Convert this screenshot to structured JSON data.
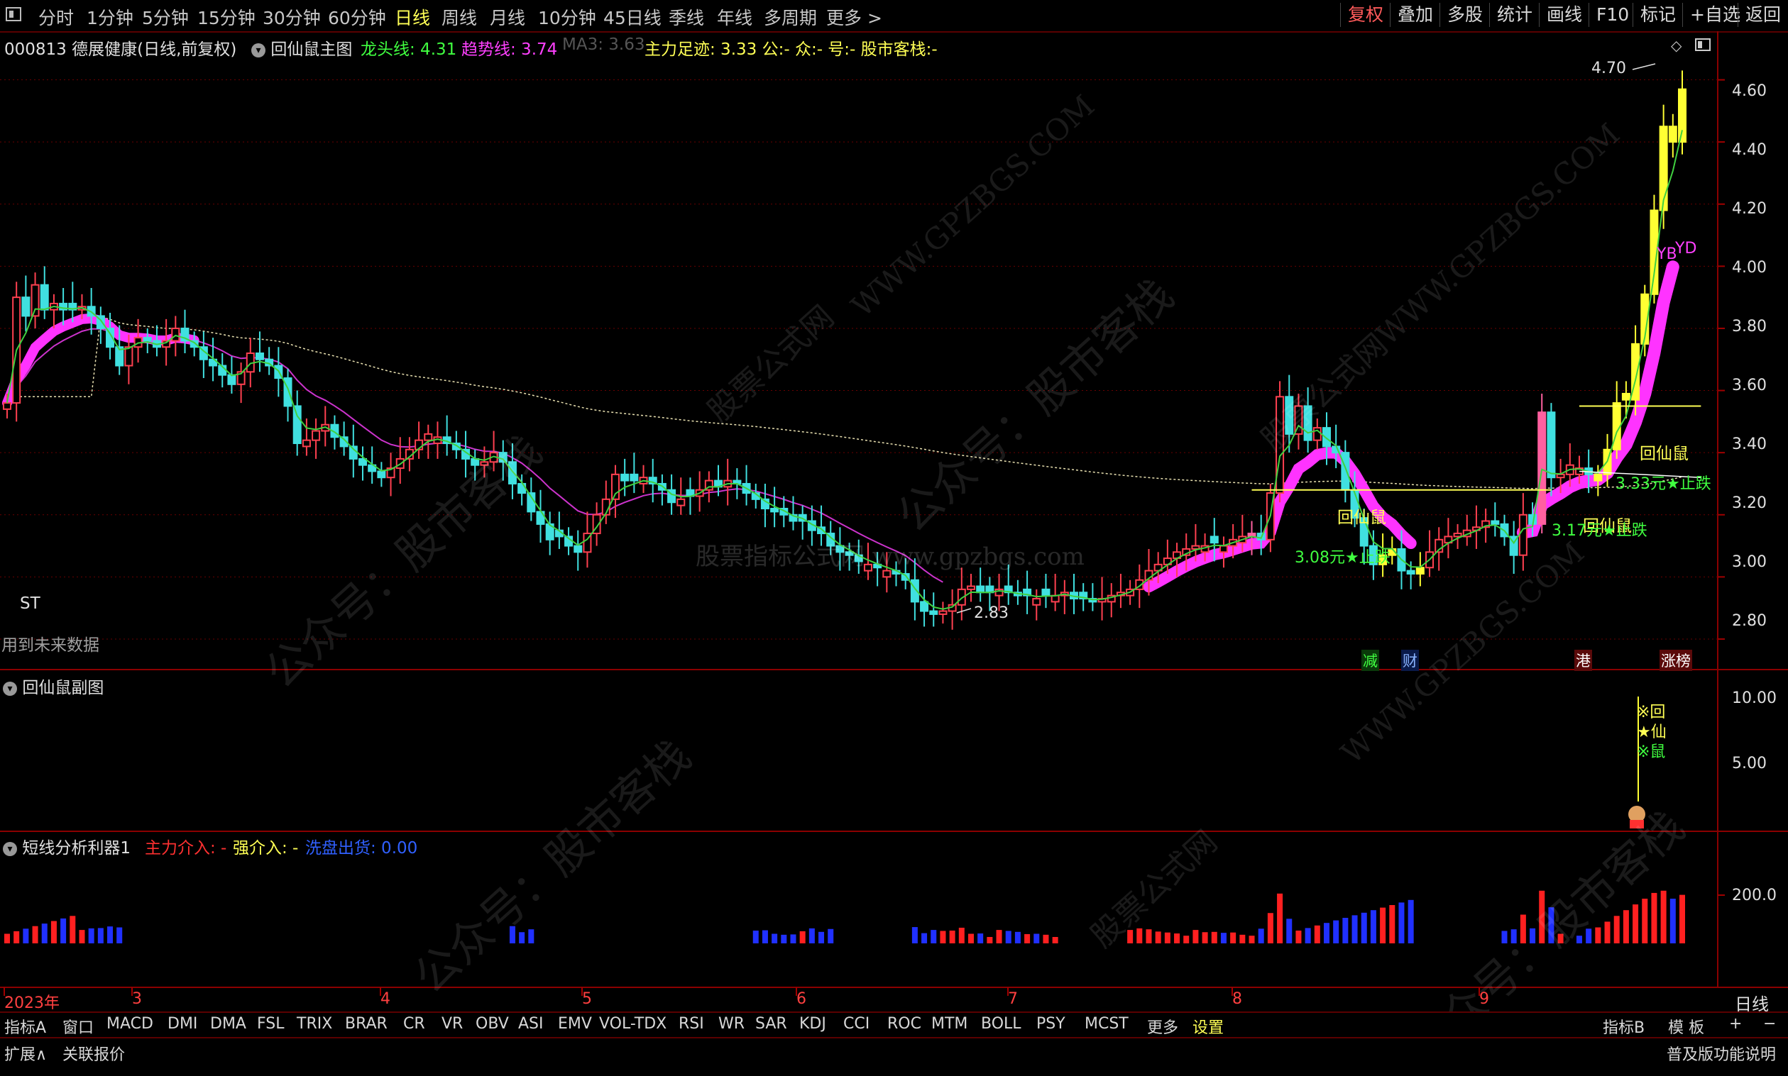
{
  "toolbar": {
    "left_icon": "window-icon",
    "tabs": [
      "分时",
      "1分钟",
      "5分钟",
      "15分钟",
      "30分钟",
      "60分钟",
      "日线",
      "周线",
      "月线",
      "10分钟",
      "45日线",
      "季线",
      "年线",
      "多周期",
      "更多 >"
    ],
    "active_tab": "日线",
    "right_buttons": [
      "复权",
      "叠加",
      "多股",
      "统计",
      "画线",
      "F10",
      "标记",
      "+自选",
      "返回"
    ],
    "active_right": "复权"
  },
  "main_header": {
    "stock": "000813 德展健康(日线,前复权)",
    "indicator": "回仙鼠主图",
    "longtou": "龙头线: 4.31",
    "qushi": "趋势线: 3.74",
    "ma3": "MA3: 3.63",
    "zhuli": "主力足迹: 3.33 公:- 众:- 号:- 股市客栈:-"
  },
  "main_panel": {
    "st_label": "ST",
    "future_label": "用到未来数据",
    "high_label": "4.70",
    "low_label": "2.83",
    "yb_label": "YB",
    "yd_label": "YD",
    "annotations": [
      "回仙鼠",
      "3.08元★止跌",
      "回仙鼠",
      "3.17元★止跌",
      "回仙鼠",
      "3.33元★止跌"
    ],
    "markers": [
      "减",
      "财",
      "港",
      "涨榜"
    ],
    "yaxis": [
      "4.60",
      "4.40",
      "4.20",
      "4.00",
      "3.80",
      "3.60",
      "3.40",
      "3.20",
      "3.00",
      "2.80"
    ]
  },
  "sub_panel": {
    "title": "回仙鼠副图",
    "yaxis": [
      "10.00",
      "5.00"
    ],
    "signal": [
      "※回",
      "★仙",
      "※鼠"
    ]
  },
  "lower_panel": {
    "title": "短线分析利器1",
    "zhuli": "主力介入: -",
    "qiang": "强介入: -",
    "xipan": "洗盘出货: 0.00",
    "yaxis": [
      "200.0"
    ]
  },
  "xaxis": {
    "labels": [
      "2023年",
      "3",
      "4",
      "5",
      "6",
      "7",
      "8",
      "9"
    ],
    "right": "日线"
  },
  "bottom_tabs": [
    "指标A",
    "窗口",
    "MACD",
    "DMI",
    "DMA",
    "FSL",
    "TRIX",
    "BRAR",
    "CR",
    "VR",
    "OBV",
    "ASI",
    "EMV",
    "VOL-TDX",
    "RSI",
    "WR",
    "SAR",
    "KDJ",
    "CCI",
    "ROC",
    "MTM",
    "BOLL",
    "PSY",
    "MCST",
    "更多",
    "设置"
  ],
  "active_bottom": "设置",
  "bottom_right": [
    "指标B",
    "模 板",
    "+",
    "−"
  ],
  "status": {
    "left": [
      "扩展∧",
      "关联报价"
    ],
    "right": "普及版功能说明"
  },
  "watermarks": [
    "公众号：股市客栈",
    "WWW.GPZBGS.COM",
    "股票公式网",
    "股票指标公式网 www.gpzbgs.com"
  ],
  "chart_data": {
    "type": "candlestick",
    "ylim": [
      2.72,
      4.72
    ],
    "x_month_labels": [
      "2023年",
      "3",
      "4",
      "5",
      "6",
      "7",
      "8",
      "9"
    ],
    "close": [
      3.56,
      3.9,
      3.84,
      3.94,
      3.86,
      3.88,
      3.86,
      3.86,
      3.87,
      3.84,
      3.8,
      3.74,
      3.68,
      3.74,
      3.77,
      3.76,
      3.74,
      3.76,
      3.8,
      3.76,
      3.74,
      3.7,
      3.68,
      3.65,
      3.62,
      3.66,
      3.72,
      3.7,
      3.68,
      3.64,
      3.55,
      3.43,
      3.44,
      3.47,
      3.49,
      3.45,
      3.42,
      3.38,
      3.36,
      3.34,
      3.32,
      3.35,
      3.38,
      3.41,
      3.44,
      3.46,
      3.45,
      3.43,
      3.41,
      3.38,
      3.36,
      3.37,
      3.4,
      3.37,
      3.3,
      3.27,
      3.21,
      3.17,
      3.12,
      3.13,
      3.1,
      3.08,
      3.14,
      3.2,
      3.25,
      3.33,
      3.31,
      3.31,
      3.32,
      3.3,
      3.28,
      3.24,
      3.25,
      3.26,
      3.28,
      3.31,
      3.29,
      3.31,
      3.3,
      3.27,
      3.25,
      3.22,
      3.21,
      3.2,
      3.18,
      3.18,
      3.15,
      3.14,
      3.1,
      3.08,
      3.07,
      3.05,
      3.04,
      3.03,
      3.02,
      3.01,
      2.99,
      2.92,
      2.89,
      2.88,
      2.89,
      2.91,
      2.96,
      2.97,
      2.95,
      2.95,
      2.96,
      2.95,
      2.94,
      2.94,
      2.93,
      2.94,
      2.94,
      2.95,
      2.93,
      2.93,
      2.92,
      2.93,
      2.94,
      2.95,
      2.96,
      2.99,
      3.02,
      3.04,
      3.06,
      3.08,
      3.09,
      3.1,
      3.1,
      3.11,
      3.1,
      3.12,
      3.13,
      3.14,
      3.12,
      3.27,
      3.58,
      3.46,
      3.55,
      3.44,
      3.48,
      3.42,
      3.4,
      3.28,
      3.19,
      3.1,
      3.04,
      3.07,
      3.09,
      3.02,
      3.01,
      3.03,
      3.08,
      3.12,
      3.13,
      3.14,
      3.15,
      3.16,
      3.18,
      3.17,
      3.13,
      3.07,
      3.2,
      3.17,
      3.53,
      3.32,
      3.33,
      3.36,
      3.35,
      3.33,
      3.33,
      3.41,
      3.56,
      3.57,
      3.75,
      3.91,
      4.18,
      4.45,
      4.4,
      4.57
    ],
    "volume_bars": "red/blue histogram in lower panel; peak near 230 at end"
  }
}
